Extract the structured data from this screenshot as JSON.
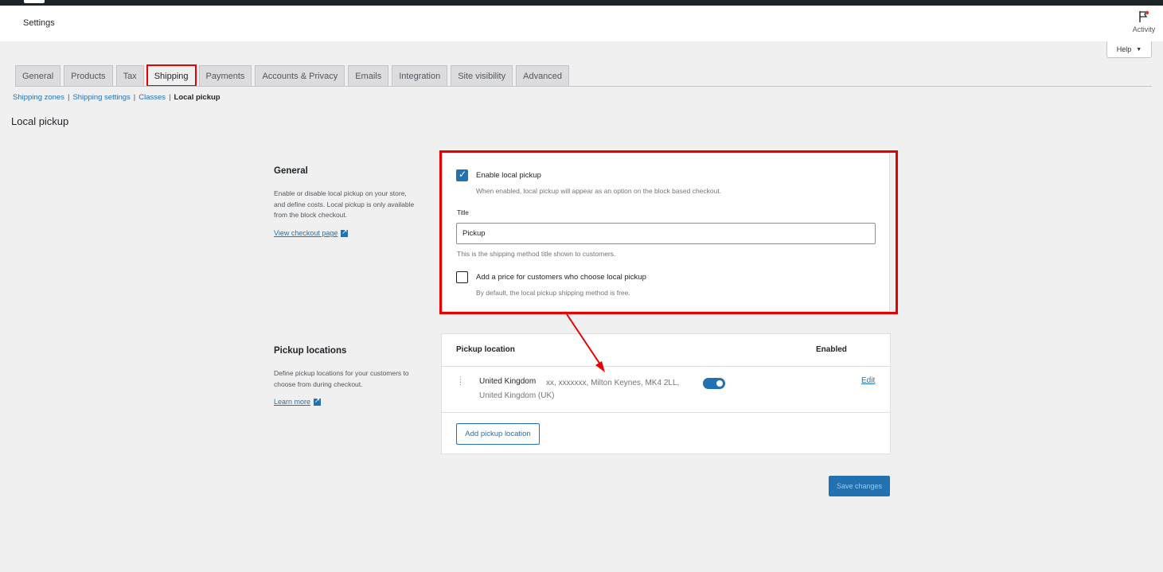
{
  "header": {
    "title": "Settings",
    "activity_label": "Activity",
    "help_label": "Help"
  },
  "tabs": [
    "General",
    "Products",
    "Tax",
    "Shipping",
    "Payments",
    "Accounts & Privacy",
    "Emails",
    "Integration",
    "Site visibility",
    "Advanced"
  ],
  "active_tab": "Shipping",
  "subnav": {
    "zones": "Shipping zones",
    "settings": "Shipping settings",
    "classes": "Classes",
    "current": "Local pickup",
    "separator": "|"
  },
  "page_title": "Local pickup",
  "general": {
    "heading": "General",
    "description": "Enable or disable local pickup on your store, and define costs. Local pickup is only available from the block checkout.",
    "link": "View checkout page",
    "enable_label": "Enable local pickup",
    "enable_checked": true,
    "enable_help": "When enabled, local pickup will appear as an option on the block based checkout.",
    "title_label": "Title",
    "title_value": "Pickup",
    "title_help": "This is the shipping method title shown to customers.",
    "price_label": "Add a price for customers who choose local pickup",
    "price_checked": false,
    "price_help": "By default, the local pickup shipping method is free."
  },
  "pickup": {
    "heading": "Pickup locations",
    "description": "Define pickup locations for your customers to choose from during checkout.",
    "link": "Learn more",
    "col_location": "Pickup location",
    "col_enabled": "Enabled",
    "locations": [
      {
        "name": "United Kingdom",
        "address": "xx, xxxxxxx, Milton Keynes, MK4 2LL, United Kingdom (UK)",
        "enabled": true,
        "edit_label": "Edit"
      }
    ],
    "add_button": "Add pickup location"
  },
  "save_button": "Save changes",
  "colors": {
    "accent": "#2271b1",
    "highlight": "#e60000",
    "background": "#f0f0f1"
  }
}
